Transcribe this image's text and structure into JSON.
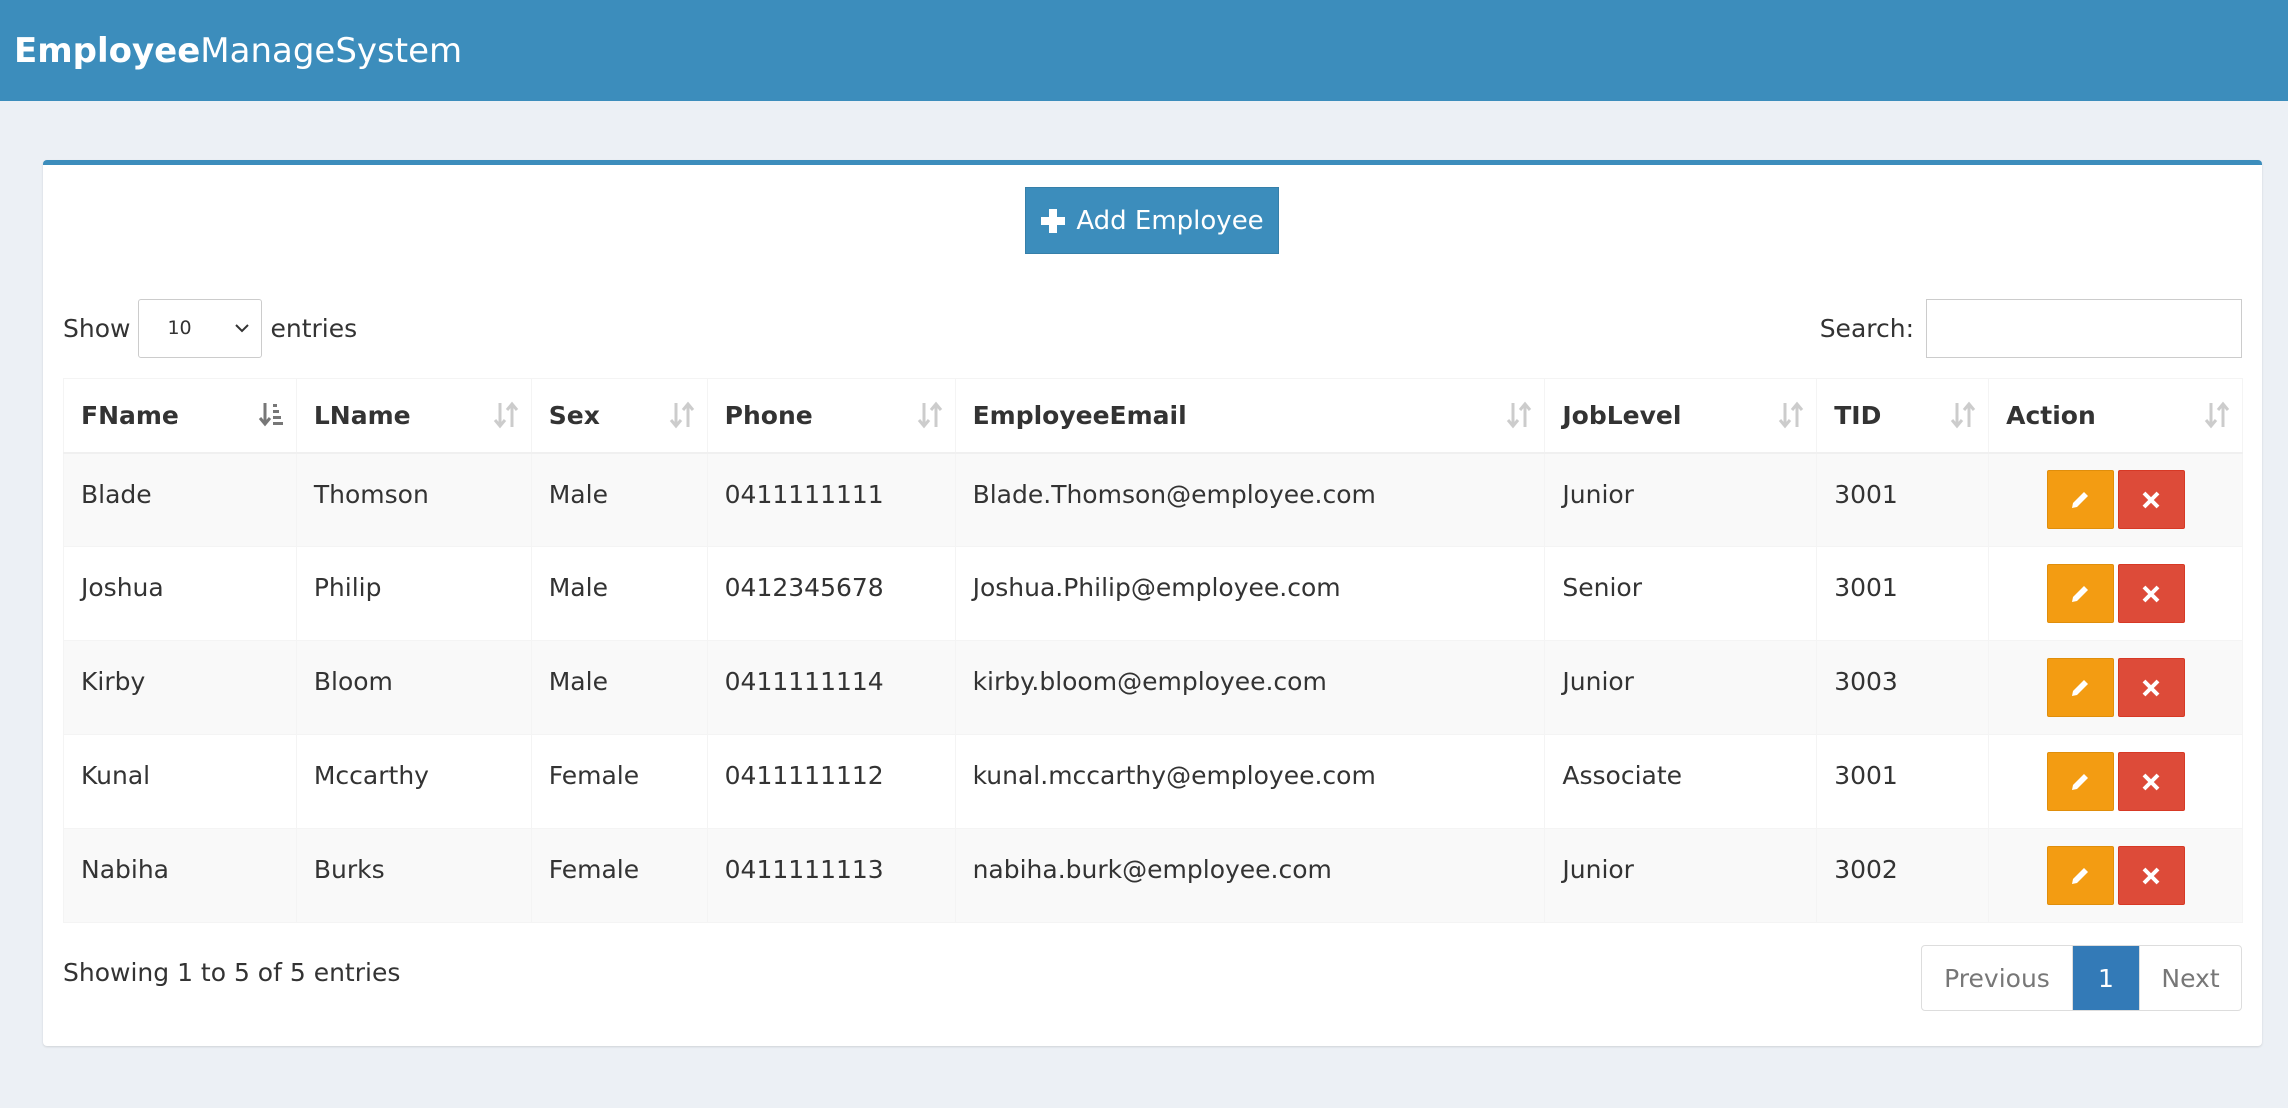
{
  "app": {
    "title_bold": "Employee",
    "title_rest": "ManageSystem"
  },
  "toolbar": {
    "add_label": "Add Employee"
  },
  "length_menu": {
    "prefix": "Show",
    "value": "10",
    "suffix": "entries"
  },
  "search": {
    "label": "Search:",
    "value": ""
  },
  "table": {
    "columns": [
      "FName",
      "LName",
      "Sex",
      "Phone",
      "EmployeeEmail",
      "JobLevel",
      "TID",
      "Action"
    ],
    "rows": [
      [
        "Blade",
        "Thomson",
        "Male",
        "0411111111",
        "Blade.Thomson@employee.com",
        "Junior",
        "3001"
      ],
      [
        "Joshua",
        "Philip",
        "Male",
        "0412345678",
        "Joshua.Philip@employee.com",
        "Senior",
        "3001"
      ],
      [
        "Kirby",
        "Bloom",
        "Male",
        "0411111114",
        "kirby.bloom@employee.com",
        "Junior",
        "3003"
      ],
      [
        "Kunal",
        "Mccarthy",
        "Female",
        "0411111112",
        "kunal.mccarthy@employee.com",
        "Associate",
        "3001"
      ],
      [
        "Nabiha",
        "Burks",
        "Female",
        "0411111113",
        "nabiha.burk@employee.com",
        "Junior",
        "3002"
      ]
    ]
  },
  "footer": {
    "info": "Showing 1 to 5 of 5 entries",
    "prev": "Previous",
    "current": "1",
    "next": "Next"
  },
  "colors": {
    "brand": "#3c8dbc",
    "edit": "#f39c12",
    "delete": "#dd4b39",
    "page_active": "#337ab7"
  },
  "icons": {
    "add": "plus-icon",
    "edit": "pencil-icon",
    "delete": "close-icon",
    "sort_active": "sort-asc-icon",
    "sort": "sort-icon"
  }
}
